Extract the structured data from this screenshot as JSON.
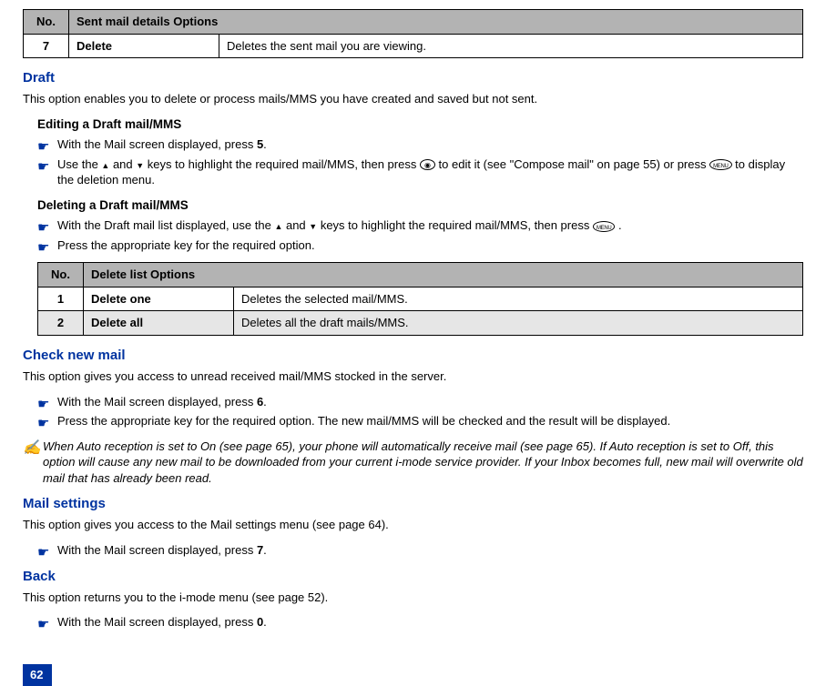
{
  "page_number": "62",
  "sent_mail_table": {
    "headers": {
      "no": "No.",
      "options": "Sent mail details Options"
    },
    "row": {
      "no": "7",
      "name": "Delete",
      "desc": "Deletes the sent mail you are viewing."
    }
  },
  "draft": {
    "title": "Draft",
    "desc": "This option enables you to delete or process mails/MMS you have created and saved but not sent.",
    "editing": {
      "title": "Editing a Draft mail/MMS",
      "step1_a": "With the Mail screen displayed, press ",
      "step1_b": "5",
      "step1_c": ".",
      "step2_a": "Use the ",
      "step2_b": " and ",
      "step2_c": " keys to highlight the required mail/MMS, then press ",
      "step2_d": " to edit it (see \"Compose mail\" on page 55) or press ",
      "step2_e": " to display the deletion menu."
    },
    "deleting": {
      "title": "Deleting a Draft mail/MMS",
      "step1_a": "With the Draft mail list displayed, use the ",
      "step1_b": " and ",
      "step1_c": " keys to highlight the required mail/MMS, then press ",
      "step1_d": " .",
      "step2": "Press the appropriate key for the required option."
    }
  },
  "delete_table": {
    "headers": {
      "no": "No.",
      "options": "Delete list Options"
    },
    "rows": [
      {
        "no": "1",
        "name": "Delete one",
        "desc": "Deletes the selected mail/MMS."
      },
      {
        "no": "2",
        "name": "Delete all",
        "desc": "Deletes all the draft mails/MMS."
      }
    ]
  },
  "check_new_mail": {
    "title": "Check new mail",
    "desc": "This option gives you access to unread received mail/MMS stocked in the server.",
    "step1_a": "With the Mail screen displayed, press ",
    "step1_b": "6",
    "step1_c": ".",
    "step2": "Press the appropriate key for the required option. The new mail/MMS will be checked and the result will be displayed.",
    "note": "When Auto reception is set to On (see page 65), your phone will automatically receive mail (see page 65). If Auto reception is set to Off, this option will cause any new mail to be downloaded from your current i-mode service provider. If your Inbox becomes full, new mail will overwrite old mail that has already been read."
  },
  "mail_settings": {
    "title": "Mail settings",
    "desc": "This option gives you access to the Mail settings menu (see page 64).",
    "step1_a": "With the Mail screen displayed, press ",
    "step1_b": "7",
    "step1_c": "."
  },
  "back": {
    "title": "Back",
    "desc": "This option returns you to the i-mode menu (see page 52).",
    "step1_a": "With the Mail screen displayed, press ",
    "step1_b": "0",
    "step1_c": "."
  },
  "icons": {
    "menu_label": "MENU"
  }
}
